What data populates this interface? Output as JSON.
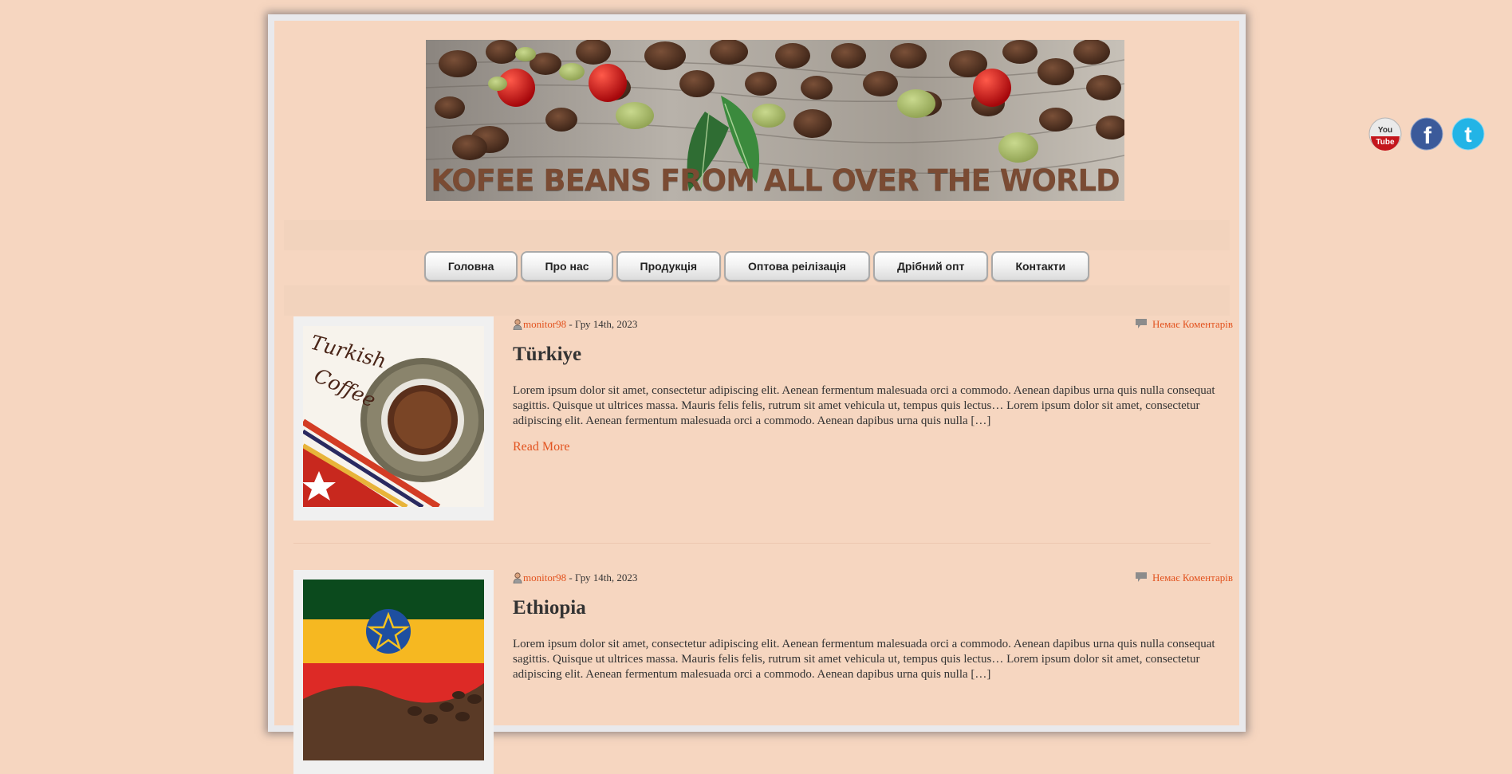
{
  "banner": {
    "title": "KOFEE BEANS FROM ALL OVER THE WORLD"
  },
  "nav": {
    "items": [
      {
        "label": "Головна"
      },
      {
        "label": "Про нас"
      },
      {
        "label": "Продукція"
      },
      {
        "label": "Оптова реілізація"
      },
      {
        "label": "Дрібний опт"
      },
      {
        "label": "Контакти"
      }
    ]
  },
  "posts": [
    {
      "author": "monitor98",
      "date_sep": " - ",
      "date": "Гру 14th, 2023",
      "comments": "Немає Коментарів",
      "title": "Türkiye",
      "excerpt": "Lorem ipsum dolor sit amet, consectetur adipiscing elit. Aenean fermentum malesuada orci a commodo. Aenean dapibus urna quis nulla consequat sagittis. Quisque ut ultrices massa. Mauris felis felis, rutrum sit amet vehicula ut, tempus quis lectus… Lorem ipsum dolor sit amet, consectetur adipiscing elit. Aenean fermentum malesuada orci a commodo. Aenean dapibus urna quis nulla […]",
      "read_more": "Read More",
      "thumb_text": "Turkish Coffee"
    },
    {
      "author": "monitor98",
      "date_sep": " - ",
      "date": "Гру 14th, 2023",
      "comments": "Немає Коментарів",
      "title": "Ethiopia",
      "excerpt": "Lorem ipsum dolor sit amet, consectetur adipiscing elit. Aenean fermentum malesuada orci a commodo. Aenean dapibus urna quis nulla consequat sagittis. Quisque ut ultrices massa. Mauris felis felis, rutrum sit amet vehicula ut, tempus quis lectus… Lorem ipsum dolor sit amet, consectetur adipiscing elit. Aenean fermentum malesuada orci a commodo. Aenean dapibus urna quis nulla […]"
    }
  ],
  "social": {
    "youtube_text": "You Tube",
    "youtube_line1": "You",
    "youtube_line2": "Tube",
    "facebook_glyph": "f",
    "twitter_glyph": "t"
  },
  "colors": {
    "background": "#f6d6c0",
    "link": "#e2531f",
    "text": "#333333"
  }
}
